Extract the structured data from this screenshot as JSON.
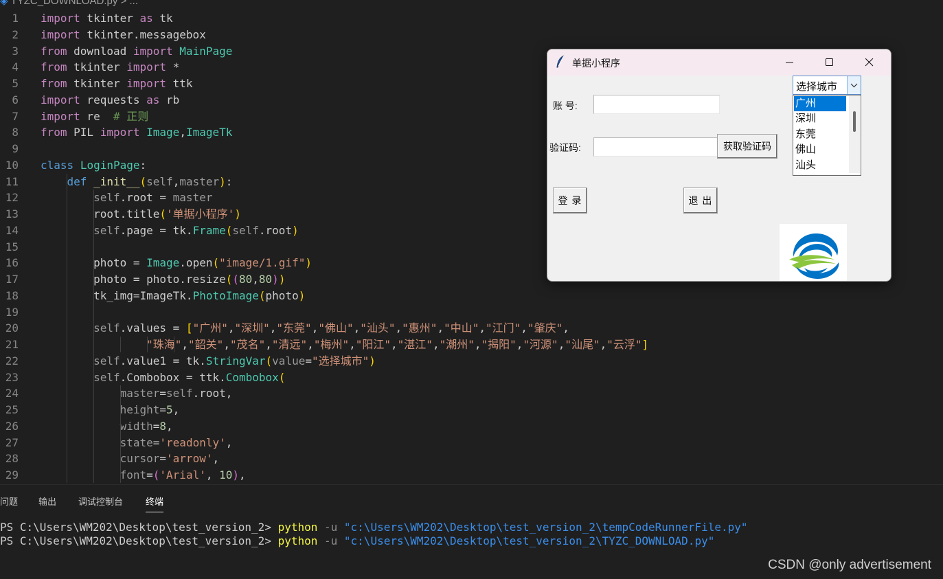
{
  "breadcrumb": {
    "file": "TYZC_DOWNLOAD.py",
    "rest": "> ..."
  },
  "editor": {
    "lines": [
      {
        "n": "1"
      },
      {
        "n": "2"
      },
      {
        "n": "3"
      },
      {
        "n": "4"
      },
      {
        "n": "5"
      },
      {
        "n": "6"
      },
      {
        "n": "7"
      },
      {
        "n": "8"
      },
      {
        "n": "9"
      },
      {
        "n": "10"
      },
      {
        "n": "11"
      },
      {
        "n": "12"
      },
      {
        "n": "13"
      },
      {
        "n": "14"
      },
      {
        "n": "15"
      },
      {
        "n": "16"
      },
      {
        "n": "17"
      },
      {
        "n": "18"
      },
      {
        "n": "19"
      },
      {
        "n": "20"
      },
      {
        "n": "21"
      },
      {
        "n": "22"
      },
      {
        "n": "23"
      },
      {
        "n": "24"
      },
      {
        "n": "25"
      },
      {
        "n": "26"
      },
      {
        "n": "27"
      },
      {
        "n": "28"
      },
      {
        "n": "29"
      }
    ]
  },
  "panel": {
    "tabs": [
      "问题",
      "输出",
      "调试控制台",
      "终端"
    ],
    "active_tab": "终端",
    "terminal": [
      {
        "prompt": "PS C:\\Users\\WM202\\Desktop\\test_version_2> ",
        "cmd": "python",
        "flag": " -u ",
        "path": "\"c:\\Users\\WM202\\Desktop\\test_version_2\\tempCodeRunnerFile.py\""
      },
      {
        "prompt": "PS C:\\Users\\WM202\\Desktop\\test_version_2> ",
        "cmd": "python",
        "flag": " -u ",
        "path": "\"c:\\Users\\WM202\\Desktop\\test_version_2\\TYZC_DOWNLOAD.py\""
      }
    ]
  },
  "watermark": "CSDN @only advertisement",
  "tk_window": {
    "title": "单据小程序",
    "account_label": "账 号:",
    "captcha_label": "验证码:",
    "get_captcha_button": "获取验证码",
    "login_button": "登 录",
    "exit_button": "退 出",
    "account_value": "",
    "captcha_value": "",
    "city_combobox": {
      "value": "选择城市",
      "visible_options": [
        "广州",
        "深圳",
        "东莞",
        "佛山",
        "汕头"
      ],
      "selected_option": "广州"
    }
  },
  "colors": {
    "editor_bg": "#1f1f1f",
    "keyword": "#569cd6",
    "string": "#ce9178",
    "class": "#4ec9b0",
    "selection": "#0078d7"
  }
}
